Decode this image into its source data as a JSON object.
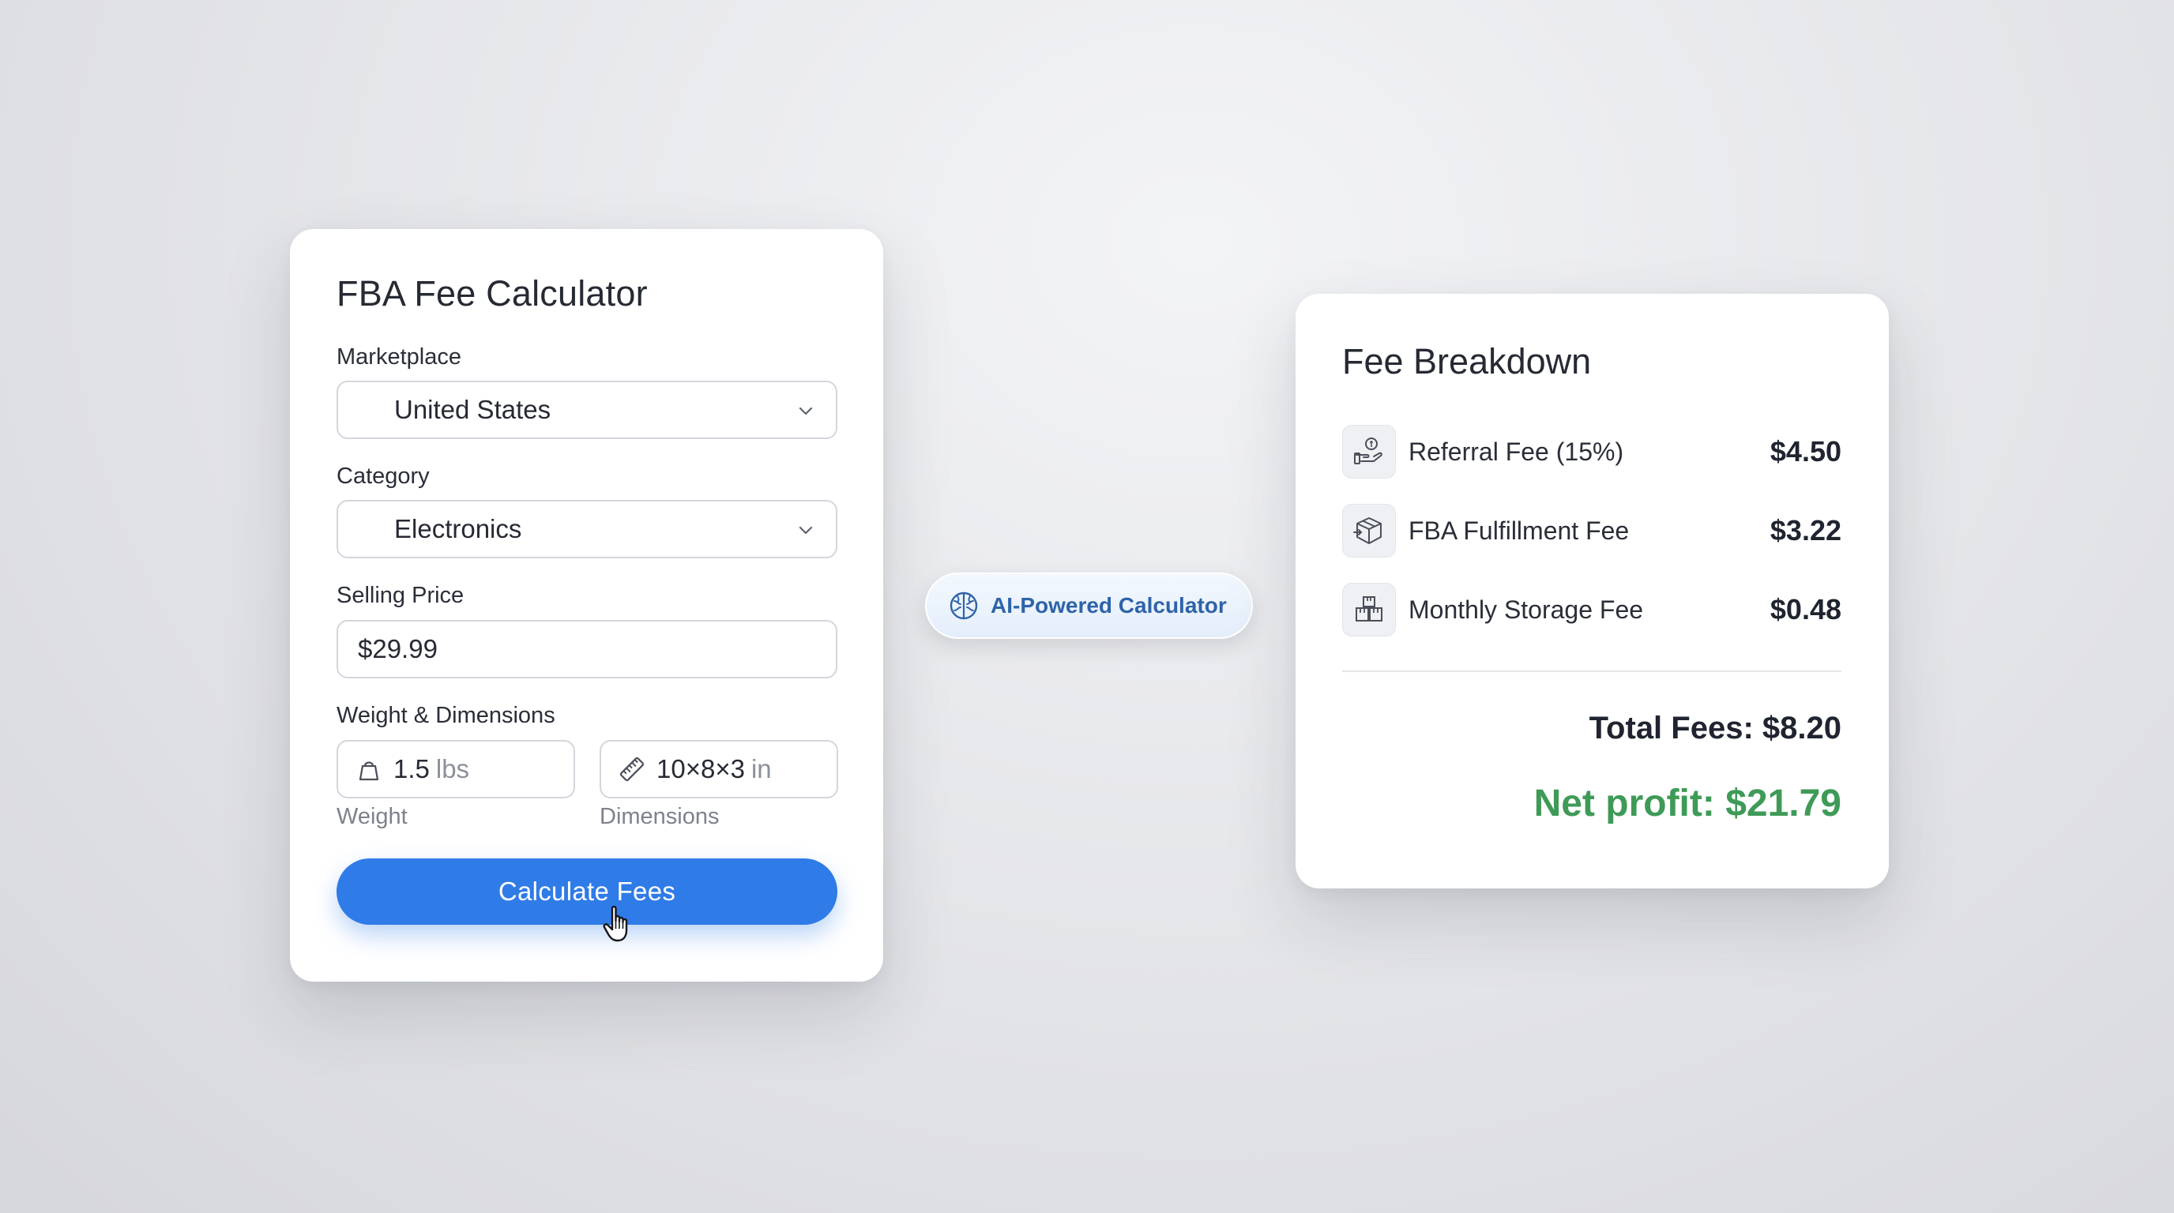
{
  "calculator": {
    "title": "FBA Fee Calculator",
    "marketplace": {
      "label": "Marketplace",
      "value": "United States"
    },
    "category": {
      "label": "Category",
      "value": "Electronics"
    },
    "selling_price": {
      "label": "Selling Price",
      "value": "$29.99"
    },
    "weight_dimensions": {
      "label": "Weight & Dimensions",
      "weight": {
        "value": "1.5",
        "unit": "lbs",
        "label": "Weight",
        "icon": "weight-icon"
      },
      "dimensions": {
        "value": "10×8×3",
        "unit": "in",
        "label": "Dimensions",
        "icon": "ruler-icon"
      }
    },
    "button_label": "Calculate Fees"
  },
  "ai_badge": {
    "label": "AI-Powered Calculator",
    "icon": "brain-icon"
  },
  "breakdown": {
    "title": "Fee Breakdown",
    "items": [
      {
        "name": "Referral Fee (15%)",
        "amount": "$4.50",
        "icon": "hand-coin-icon"
      },
      {
        "name": "FBA Fulfillment Fee",
        "amount": "$3.22",
        "icon": "package-icon"
      },
      {
        "name": "Monthly Storage Fee",
        "amount": "$0.48",
        "icon": "boxes-icon"
      }
    ],
    "total": "Total Fees: $8.20",
    "net_profit": "Net profit: $21.79"
  },
  "colors": {
    "primary": "#2f7be7",
    "accent_text": "#2e63a8",
    "profit": "#3f9a57"
  }
}
